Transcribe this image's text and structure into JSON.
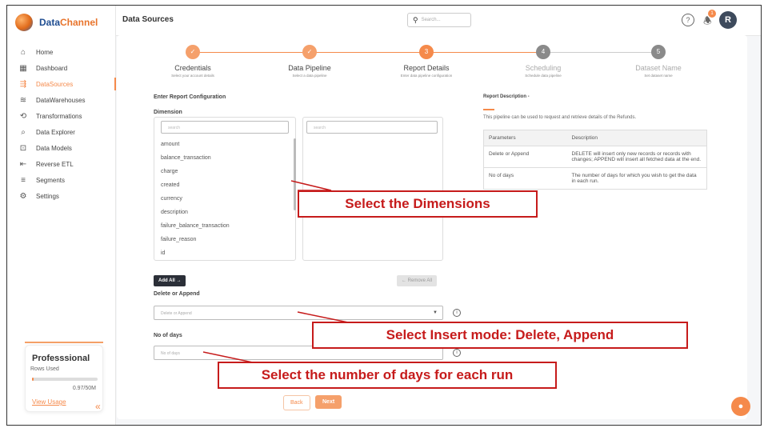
{
  "sidebar": {
    "logo": {
      "part1": "Data",
      "part2": "Channel"
    },
    "items": [
      {
        "label": "Home",
        "icon": "⌂",
        "active": false
      },
      {
        "label": "Dashboard",
        "icon": "▦",
        "active": false
      },
      {
        "label": "DataSources",
        "icon": "⇶",
        "active": true
      },
      {
        "label": "DataWarehouses",
        "icon": "≋",
        "active": false
      },
      {
        "label": "Transformations",
        "icon": "⟲",
        "active": false
      },
      {
        "label": "Data Explorer",
        "icon": "⌕",
        "active": false
      },
      {
        "label": "Data Models",
        "icon": "⊡",
        "active": false
      },
      {
        "label": "Reverse ETL",
        "icon": "⇤",
        "active": false
      },
      {
        "label": "Segments",
        "icon": "≡",
        "active": false
      },
      {
        "label": "Settings",
        "icon": "⚙",
        "active": false
      }
    ],
    "plan": {
      "title": "Professsional",
      "rows_label": "Rows Used",
      "count": "0.97/50M",
      "usage_fraction": 0.02,
      "link": "View Usage"
    },
    "collapse_glyph": "«"
  },
  "header": {
    "title": "Data Sources",
    "search_placeholder": "Search...",
    "help_glyph": "?",
    "notification_count": "1",
    "avatar_initial": "R"
  },
  "stepper": {
    "steps": [
      {
        "name": "Credentials",
        "sub": "Select your account details",
        "state": "done",
        "marker": "✓"
      },
      {
        "name": "Data Pipeline",
        "sub": "Select a data pipeline",
        "state": "done",
        "marker": "✓"
      },
      {
        "name": "Report Details",
        "sub": "Enter data pipeline configuration",
        "state": "current",
        "marker": "3"
      },
      {
        "name": "Scheduling",
        "sub": "Schedule data pipeline",
        "state": "todo",
        "marker": "4"
      },
      {
        "name": "Dataset Name",
        "sub": "Set dataset name",
        "state": "todo",
        "marker": "5"
      }
    ]
  },
  "config": {
    "heading": "Enter Report Configuration",
    "dimension_label": "Dimension",
    "left_search_placeholder": "search",
    "right_search_placeholder": "search",
    "dimensions": [
      "amount",
      "balance_transaction",
      "charge",
      "created",
      "currency",
      "description",
      "failure_balance_transaction",
      "failure_reason",
      "id"
    ],
    "add_all": "Add All →",
    "remove_all": "← Remove All",
    "delete_append_label": "Delete or Append",
    "delete_append_placeholder": "Delete or Append",
    "no_of_days_label": "No of days",
    "no_of_days_placeholder": "No of days",
    "info_glyph": "i"
  },
  "report": {
    "title": "Report Description -",
    "description": "This pipeline can be used to request and retrieve details of the Refunds.",
    "columns": [
      "Parameters",
      "Description"
    ],
    "rows": [
      [
        "Delete or Append",
        "DELETE will insert only new records or records with changes; APPEND will insert all fetched data at the end."
      ],
      [
        "No of days",
        "The number of days for which you wish to get the data in each run."
      ]
    ]
  },
  "footer": {
    "back": "Back",
    "next": "Next"
  },
  "annotations": {
    "dimensions": "Select the Dimensions",
    "insert_mode": "Select Insert mode: Delete, Append",
    "days": "Select the number of days for each run"
  },
  "colors": {
    "accent": "#f58a4b",
    "annotation": "#c61b1b",
    "dark_button": "#2b2f38"
  }
}
